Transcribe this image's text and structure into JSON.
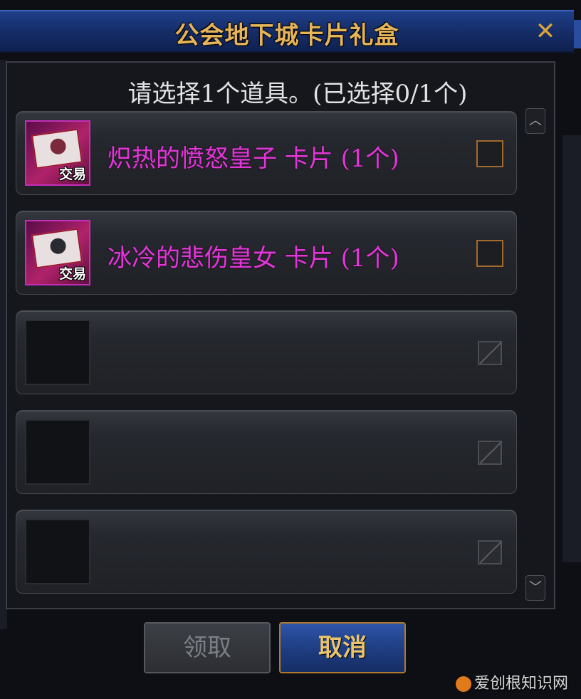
{
  "window": {
    "title": "公会地下城卡片礼盒",
    "close_glyph": "✕"
  },
  "prompt": "请选择1个道具。(已选择0/1个)",
  "items": [
    {
      "name": "炽热的愤怒皇子 卡片 (1个)",
      "badge": "交易",
      "color": "#e037d6"
    },
    {
      "name": "冰冷的悲伤皇女 卡片 (1个)",
      "badge": "交易",
      "color": "#e037d6"
    }
  ],
  "empty_slots": 3,
  "buttons": {
    "claim": "领取",
    "cancel": "取消"
  },
  "scroll": {
    "up_glyph": "︿",
    "down_glyph": "﹀"
  },
  "watermark": "爱创根知识网",
  "icons": {
    "close": "close-icon",
    "card": "card-icon",
    "checkbox": "checkbox-icon"
  }
}
